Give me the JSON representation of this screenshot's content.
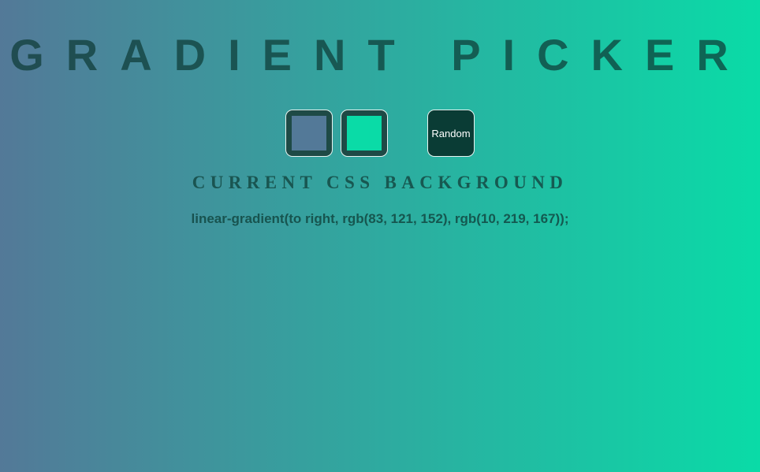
{
  "header": {
    "title": "GRADIENT PICKER"
  },
  "picker": {
    "color1": {
      "value": "#537998",
      "rgb": "rgb(83, 121, 152)"
    },
    "color2": {
      "value": "#0adba7",
      "rgb": "rgb(10, 219, 167)"
    },
    "random_label": "Random"
  },
  "output": {
    "heading": "CURRENT CSS BACKGROUND",
    "css_text": "linear-gradient(to right, rgb(83, 121, 152), rgb(10, 219, 167));"
  },
  "colors": {
    "text_dark": "#0e3b36",
    "swatch_border": "#e8f3f0",
    "swatch_frame": "#1e4a46",
    "button_bg": "#0a3c35",
    "button_text": "#ffffff"
  }
}
